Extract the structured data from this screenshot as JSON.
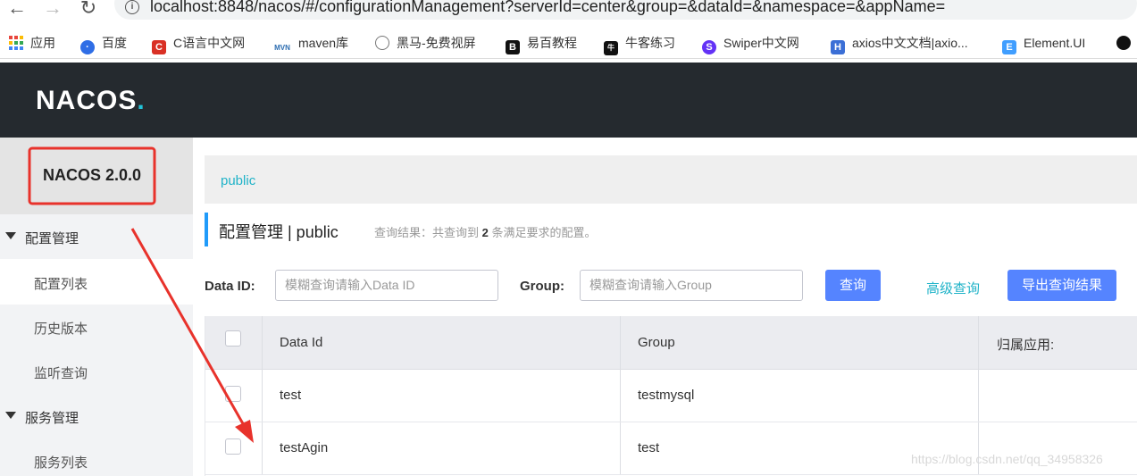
{
  "browser": {
    "url": "localhost:8848/nacos/#/configurationManagement?serverId=center&group=&dataId=&namespace=&appName=",
    "bookmarks": [
      {
        "label": "应用",
        "icon": "apps-grid-icon",
        "color": "#e8453c"
      },
      {
        "label": "百度",
        "icon": "baidu-paw-icon",
        "color": "#2f6ee6"
      },
      {
        "label": "C语言中文网",
        "icon": "c-icon",
        "color": "#d93025"
      },
      {
        "label": "maven库",
        "icon": "mvn-icon",
        "color": "#2b6cb0"
      },
      {
        "label": "黑马-免费视屏",
        "icon": "heima-icon",
        "color": "#777777"
      },
      {
        "label": "易百教程",
        "icon": "b-icon",
        "color": "#111111"
      },
      {
        "label": "牛客练习",
        "icon": "niuke-icon",
        "color": "#111111"
      },
      {
        "label": "Swiper中文网",
        "icon": "swiper-s-icon",
        "color": "#6332f6"
      },
      {
        "label": "axios中文文档|axio...",
        "icon": "axios-h-icon",
        "color": "#3b6fd6"
      },
      {
        "label": "Element.UI",
        "icon": "element-hex-icon",
        "color": "#409eff"
      }
    ]
  },
  "header": {
    "logo_text": "NACOS",
    "logo_dot": "."
  },
  "sidebar": {
    "version": "NACOS 2.0.0",
    "groups": [
      {
        "label": "配置管理",
        "items": [
          "配置列表",
          "历史版本",
          "监听查询"
        ]
      },
      {
        "label": "服务管理",
        "items": [
          "服务列表"
        ]
      }
    ]
  },
  "main": {
    "namespace": "public",
    "title": "配置管理  |  public",
    "result_prefix": "查询结果：共查询到",
    "result_count": "2",
    "result_suffix": "条满足要求的配置。",
    "search": {
      "dataid_label": "Data ID:",
      "dataid_placeholder": "模糊查询请输入Data ID",
      "group_label": "Group:",
      "group_placeholder": "模糊查询请输入Group",
      "query_button": "查询",
      "advanced_link": "高级查询",
      "export_button": "导出查询结果"
    },
    "table": {
      "columns": [
        "Data Id",
        "Group",
        "归属应用:"
      ],
      "rows": [
        {
          "data_id": "test",
          "group": "testmysql",
          "app": ""
        },
        {
          "data_id": "testAgin",
          "group": "test",
          "app": ""
        }
      ]
    }
  },
  "watermark": "https://blog.csdn.net/qq_34958326",
  "colors": {
    "header_bg": "#252a2f",
    "accent_cyan": "#20b3c8",
    "primary_blue": "#5584ff",
    "annotation_red": "#e8322b"
  }
}
